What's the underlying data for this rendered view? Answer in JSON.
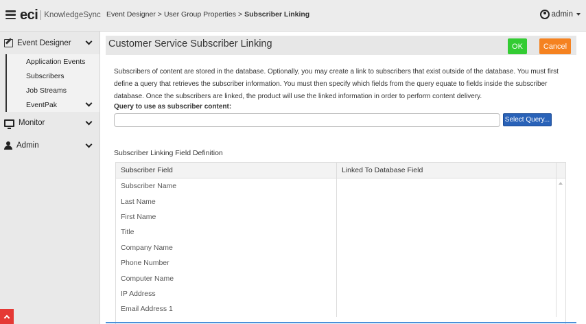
{
  "header": {
    "logo_brand": "eci",
    "logo_product": "KnowledgeSync",
    "breadcrumb": [
      "Event Designer",
      "User Group Properties",
      "Subscriber Linking"
    ],
    "breadcrumb_separator": ">",
    "user": "admin"
  },
  "sidebar": {
    "event_designer": "Event Designer",
    "sub_items": [
      "Application Events",
      "Subscribers",
      "Job Streams",
      "EventPak"
    ],
    "monitor": "Monitor",
    "admin": "Admin"
  },
  "main": {
    "title": "Customer Service Subscriber Linking",
    "ok_label": "OK",
    "cancel_label": "Cancel",
    "description": "Subscribers of content are stored in the database. Optionally, you may create a link to subscribers that exist outside of the database. You must first define a query that retrieves the subscriber information. You must then specify which fields from the query equate to fields inside the subscriber database. Once the subscribers are linked, the product will use the linked information in order to perform content delivery.",
    "query_label": "Query to use as subscriber content:",
    "query_value": "",
    "select_query_label": "Select Query...",
    "section_title": "Subscriber Linking Field Definition",
    "grid": {
      "columns": [
        "Subscriber Field",
        "Linked To Database Field"
      ],
      "rows": [
        [
          "Subscriber Name",
          ""
        ],
        [
          "Last Name",
          ""
        ],
        [
          "First Name",
          ""
        ],
        [
          "Title",
          ""
        ],
        [
          "Company Name",
          ""
        ],
        [
          "Phone Number",
          ""
        ],
        [
          "Computer Name",
          ""
        ],
        [
          "IP Address",
          ""
        ],
        [
          "Email Address 1",
          ""
        ]
      ]
    }
  },
  "colors": {
    "ok": "#33cc33",
    "cancel": "#f58220",
    "select_query": "#2962b8",
    "scroll_top": "#e53935"
  }
}
